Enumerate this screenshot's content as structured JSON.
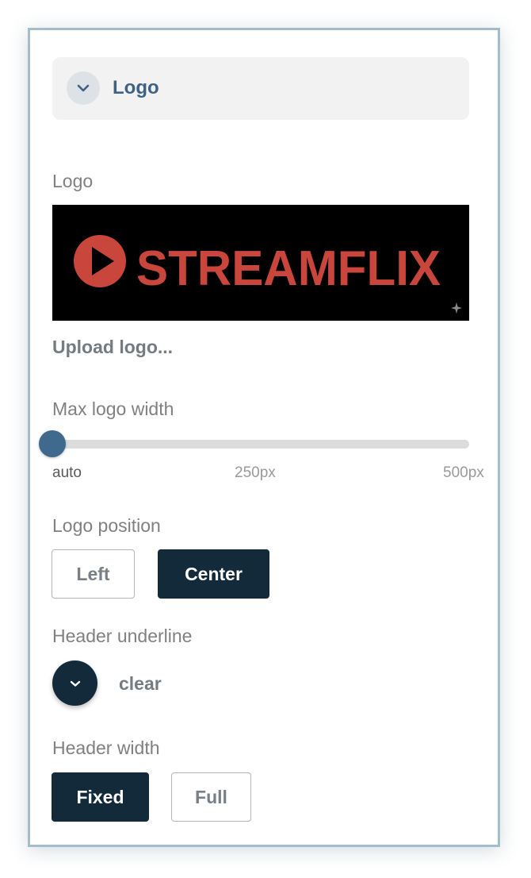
{
  "section": {
    "title": "Logo",
    "collapse_icon": "chevron-down-icon"
  },
  "logo": {
    "label": "Logo",
    "image_text": "STREAMFLIX",
    "brand_color": "#c8463b",
    "upload_label": "Upload logo..."
  },
  "max_width": {
    "label": "Max logo width",
    "ticks": [
      "auto",
      "250px",
      "500px"
    ],
    "value": "auto"
  },
  "position": {
    "label": "Logo position",
    "options": [
      "Left",
      "Center"
    ],
    "selected": "Center"
  },
  "underline": {
    "label": "Header underline",
    "value": "clear",
    "icon": "chevron-down-icon"
  },
  "header_width": {
    "label": "Header width",
    "options": [
      "Fixed",
      "Full"
    ],
    "selected": "Fixed"
  },
  "colors": {
    "accent": "#3f6a8e",
    "dark": "#132a3b",
    "panel_border": "#a5bccb"
  }
}
